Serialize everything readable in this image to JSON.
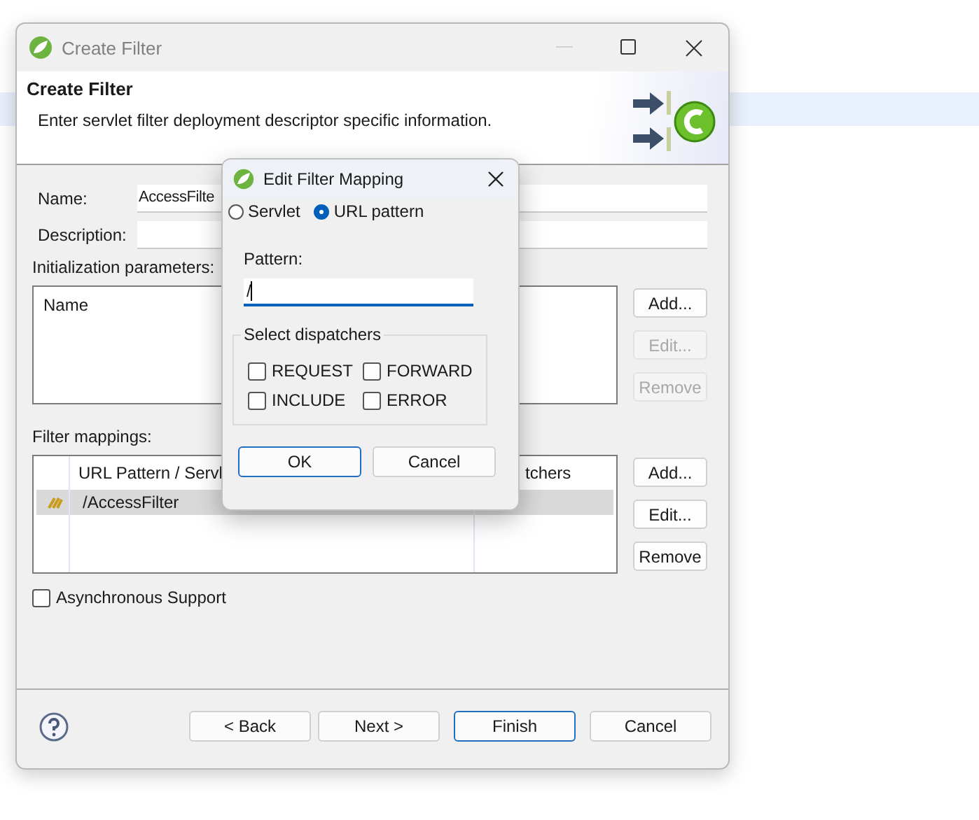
{
  "window": {
    "title": "Create Filter"
  },
  "banner": {
    "title": "Create Filter",
    "description": "Enter servlet filter deployment descriptor specific information."
  },
  "form": {
    "name_label": "Name:",
    "name_value": "AccessFilte",
    "description_label": "Description:"
  },
  "init_params": {
    "label": "Initialization parameters:",
    "columns": [
      "Name"
    ],
    "buttons": [
      {
        "label": "Add...",
        "disabled": false
      },
      {
        "label": "Edit...",
        "disabled": true
      },
      {
        "label": "Remove",
        "disabled": true
      }
    ]
  },
  "filter_mappings": {
    "label": "Filter mappings:",
    "columns": [
      "URL Pattern / Servl",
      "tchers"
    ],
    "rows": [
      {
        "value": "/AccessFilter",
        "selected": true
      }
    ],
    "buttons": [
      {
        "label": "Add...",
        "disabled": false
      },
      {
        "label": "Edit...",
        "disabled": false
      },
      {
        "label": "Remove",
        "disabled": false
      }
    ]
  },
  "async_support": {
    "label": "Asynchronous Support",
    "checked": false
  },
  "footer_buttons": [
    {
      "label": "< Back",
      "default": false
    },
    {
      "label": "Next >",
      "default": false
    },
    {
      "label": "Finish",
      "default": true
    },
    {
      "label": "Cancel",
      "default": false
    }
  ],
  "dialog": {
    "title": "Edit Filter Mapping",
    "radios": [
      {
        "label": "Servlet",
        "selected": false
      },
      {
        "label": "URL pattern",
        "selected": true
      }
    ],
    "pattern_label": "Pattern:",
    "pattern_value": "/",
    "group_label": "Select dispatchers",
    "checkboxes": [
      {
        "label": "REQUEST",
        "checked": false
      },
      {
        "label": "FORWARD",
        "checked": false
      },
      {
        "label": "INCLUDE",
        "checked": false
      },
      {
        "label": "ERROR",
        "checked": false
      }
    ],
    "buttons": [
      {
        "label": "OK",
        "default": true
      },
      {
        "label": "Cancel",
        "default": false
      }
    ]
  }
}
